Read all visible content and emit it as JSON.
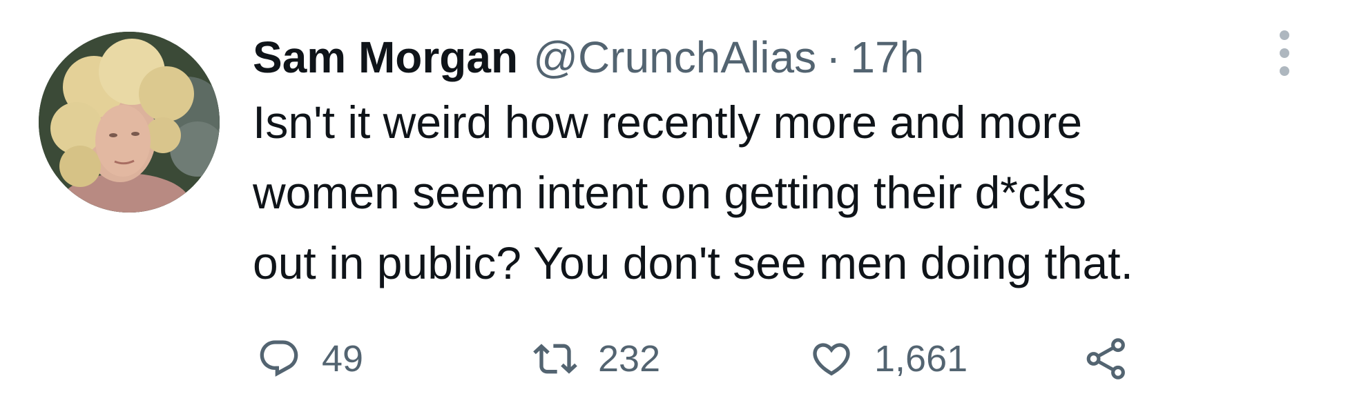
{
  "author": {
    "display_name": "Sam Morgan",
    "handle": "@CrunchAlias",
    "separator": "·",
    "timestamp": "17h"
  },
  "tweet": {
    "text_lines": [
      "Isn't it weird how recently more and more",
      "women seem intent on getting their d*cks",
      "out in public? You don't see men doing that."
    ]
  },
  "actions": {
    "reply": {
      "icon": "reply-icon",
      "count": "49"
    },
    "retweet": {
      "icon": "retweet-icon",
      "count": "232"
    },
    "like": {
      "icon": "heart-icon",
      "count": "1,661"
    },
    "share": {
      "icon": "share-icon"
    }
  },
  "colors": {
    "text": "#0f1419",
    "secondary": "#536471",
    "more_dots": "#aeb7bf"
  }
}
